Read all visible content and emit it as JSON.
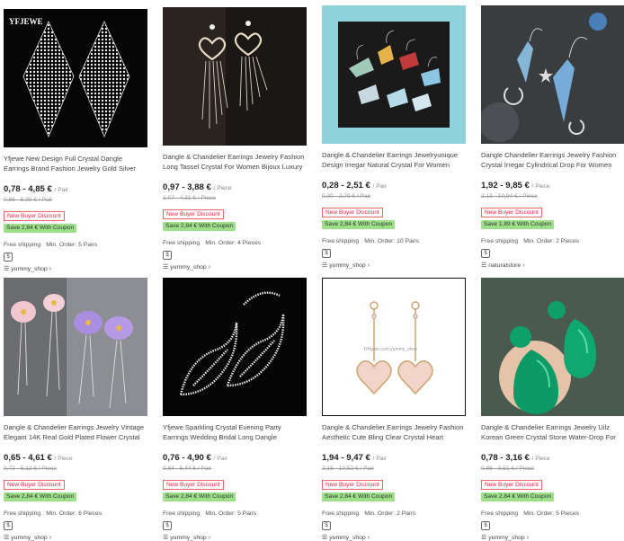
{
  "products": [
    {
      "title": "Yfjewe New Design Full Crystal Dangle Earrings Brand Fashion Jewelry Gold Silver",
      "price": "0,78 - 4,85 €",
      "unit": "/ Pair",
      "original": "0,86 - 5,39 € / Pair",
      "badge_discount": "New Buyer Discount",
      "badge_save": "Save 2,84 € With Coupon",
      "shipping": "Free shipping",
      "min_order": "Min. Order: 5 Pairs",
      "currency_icon": "$",
      "store": "yummy_shop",
      "image_logo": "YFJEWE"
    },
    {
      "title": "Dangle & Chandelier Earrings Jewelry Fashion Long Tassel Crystal For Women Bijoux Luxury",
      "price": "0,97 - 3,88 €",
      "unit": "/ Piece",
      "original": "1,07 - 4,31 € / Piece",
      "badge_discount": "New Buyer Discount",
      "badge_save": "Save 2,84 € With Coupon",
      "shipping": "Free shipping",
      "min_order": "Min. Order: 4 Pieces",
      "currency_icon": "$",
      "store": "yummy_shop"
    },
    {
      "title": "Dangle & Chandelier Earrings Jewelryunique Design Irregar Natural Crystal For Women",
      "price": "0,28 - 2,51 €",
      "unit": "/ Pair",
      "original": "0,30 - 2,79 € / Pair",
      "badge_discount": "New Buyer Discount",
      "badge_save": "Save 2,84 € With Coupon",
      "shipping": "Free shipping",
      "min_order": "Min. Order: 10 Pairs",
      "currency_icon": "$",
      "store": "yummy_shop"
    },
    {
      "title": "Dangle Chandelier Earrings Jewelry Fashion Crystal Irregar Cylindrical Drop For Women",
      "price": "1,92 - 9,85 €",
      "unit": "/ Piece",
      "original": "2,13 - 10,94 € / Piece",
      "badge_discount": "New Buyer Discount",
      "badge_save": "Save 1,89 € With Coupon",
      "shipping": "Free shipping",
      "min_order": "Min. Order: 2 Pieces",
      "currency_icon": "$",
      "store": "naturalstore"
    },
    {
      "title": "Dangle & Chandelier Earrings Jewelry Vintage Elegant 14K Real Gold Plated Flower Crystal",
      "price": "0,65 - 4,61 €",
      "unit": "/ Piece",
      "original": "0,72 - 5,12 € / Piece",
      "badge_discount": "New Buyer Discount",
      "badge_save": "Save 2,84 € With Coupon",
      "shipping": "Free shipping",
      "min_order": "Min. Order: 6 Pieces",
      "currency_icon": "$",
      "store": "yummy_shop"
    },
    {
      "title": "Yfjewe Sparkling Crystal Evening Party Earrings Wedding Bridal Long Dangle",
      "price": "0,76 - 4,90 €",
      "unit": "/ Pair",
      "original": "0,84 - 5,44 € / Pair",
      "badge_discount": "New Buyer Discount",
      "badge_save": "Save 2,84 € With Coupon",
      "shipping": "Free shipping",
      "min_order": "Min. Order: 5 Pairs",
      "currency_icon": "$",
      "store": "yummy_shop"
    },
    {
      "title": "Dangle & Chandelier Earrings Jewelry Fashion Aesthetic Cute Bling Clear Crystal Heart",
      "price": "1,94 - 9,47 €",
      "unit": "/ Pair",
      "original": "2,15 - 10,52 € / Pair",
      "badge_discount": "New Buyer Discount",
      "badge_save": "Save 2,84 € With Coupon",
      "shipping": "Free shipping",
      "min_order": "Min. Order: 2 Pairs",
      "currency_icon": "$",
      "store": "yummy_shop",
      "image_watermark": "DHgate.com yummy_shop"
    },
    {
      "title": "Dangle & Chandelier Earrings Jewelry Uilz Korean Green Crystal Stone Water-Drop For",
      "price": "0,78 - 3,16 €",
      "unit": "/ Piece",
      "original": "0,86 - 3,51 € / Piece",
      "badge_discount": "New Buyer Discount",
      "badge_save": "Save 2,84 € With Coupon",
      "shipping": "Free shipping",
      "min_order": "Min. Order: 5 Pieces",
      "currency_icon": "$",
      "store": "yummy_shop"
    }
  ]
}
